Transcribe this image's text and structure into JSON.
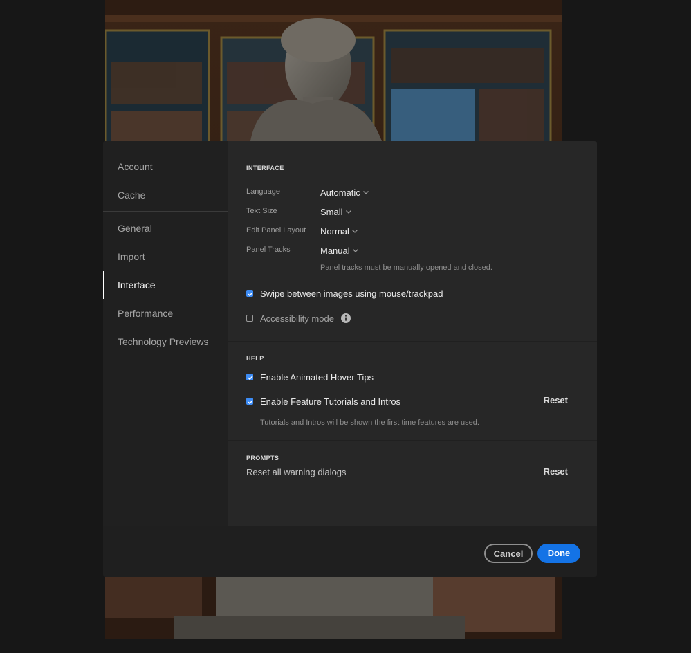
{
  "sidebar": {
    "items": [
      {
        "id": "account",
        "label": "Account"
      },
      {
        "id": "cache",
        "label": "Cache"
      },
      {
        "id": "general",
        "label": "General"
      },
      {
        "id": "import",
        "label": "Import"
      },
      {
        "id": "interface",
        "label": "Interface",
        "active": true
      },
      {
        "id": "performance",
        "label": "Performance"
      },
      {
        "id": "technology-previews",
        "label": "Technology Previews"
      }
    ]
  },
  "interface": {
    "title": "INTERFACE",
    "language": {
      "label": "Language",
      "value": "Automatic"
    },
    "text_size": {
      "label": "Text Size",
      "value": "Small"
    },
    "edit_panel_layout": {
      "label": "Edit Panel Layout",
      "value": "Normal"
    },
    "panel_tracks": {
      "label": "Panel Tracks",
      "value": "Manual",
      "hint": "Panel tracks must be manually opened and closed."
    },
    "swipe": {
      "label": "Swipe between images using mouse/trackpad",
      "checked": true
    },
    "accessibility": {
      "label": "Accessibility mode",
      "checked": false,
      "icon": "info-icon"
    }
  },
  "help": {
    "title": "HELP",
    "hover_tips": {
      "label": "Enable Animated Hover Tips",
      "checked": true
    },
    "tutorials": {
      "label": "Enable Feature Tutorials and Intros",
      "checked": true,
      "hint": "Tutorials and Intros will be shown the first time features are used."
    },
    "reset_label": "Reset"
  },
  "prompts": {
    "title": "PROMPTS",
    "label": "Reset all warning dialogs",
    "reset_label": "Reset"
  },
  "footer": {
    "cancel_label": "Cancel",
    "done_label": "Done"
  },
  "colors": {
    "accent": "#1473e6",
    "checkbox": "#3d8cf5",
    "dialog_bg": "#1f1f1f",
    "content_bg": "#272727"
  }
}
